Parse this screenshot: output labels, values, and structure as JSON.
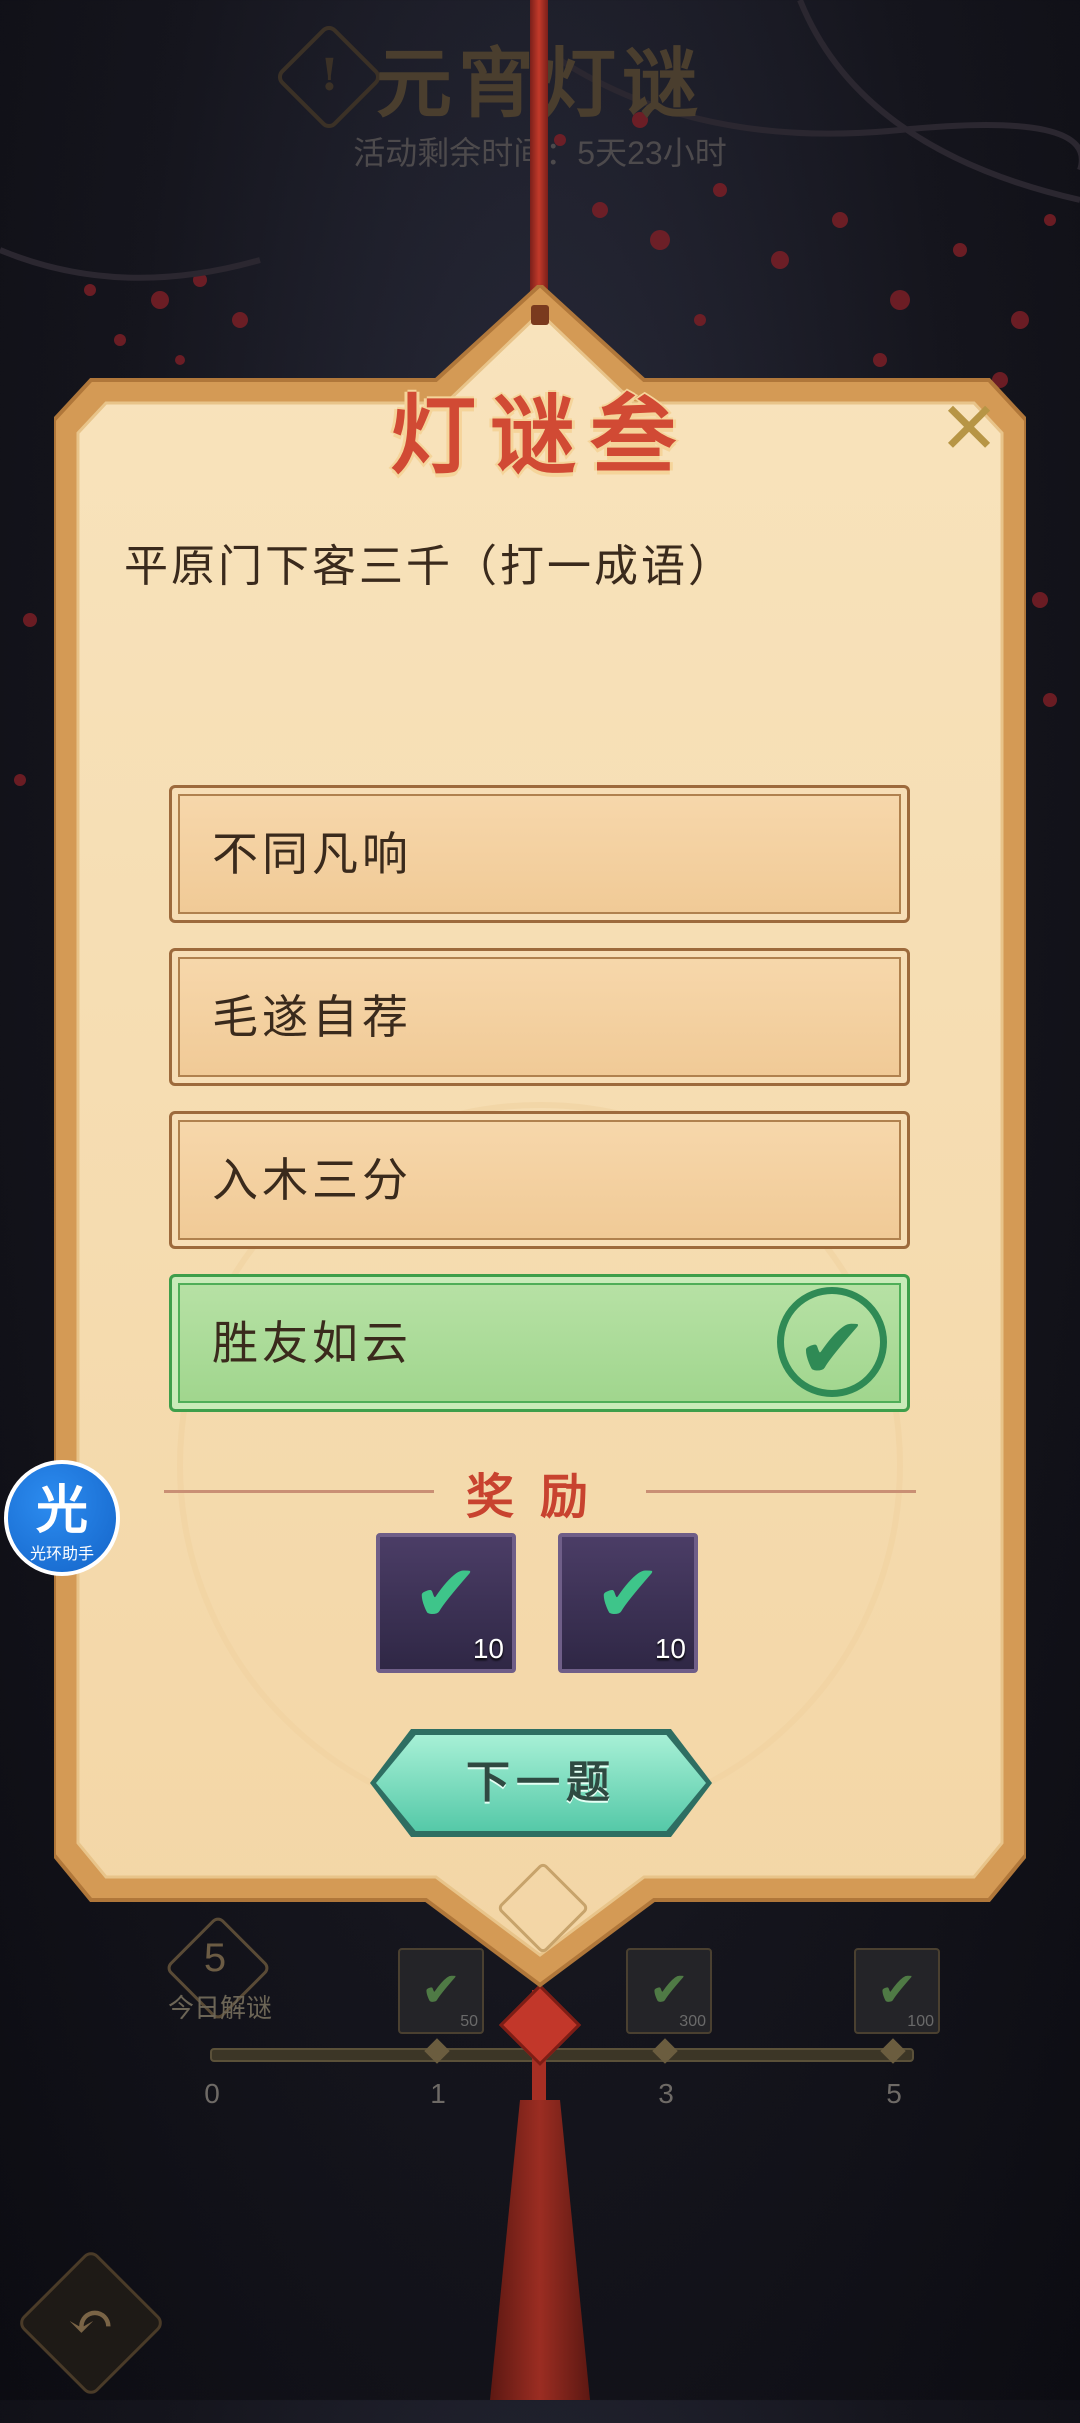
{
  "background": {
    "event_title": "元宵灯谜",
    "timer_text": "活动剩余时间：5天23小时",
    "solved_count": "5",
    "solved_label": "今日解谜",
    "progress_ticks": [
      "0",
      "1",
      "3",
      "5"
    ],
    "milestone_rewards": [
      {
        "amount": "50"
      },
      {
        "amount": "300"
      },
      {
        "amount": "100"
      }
    ]
  },
  "card": {
    "title": "灯谜叁",
    "question": "平原门下客三千（打一成语）",
    "options": [
      {
        "label": "不同凡响",
        "correct": false
      },
      {
        "label": "毛遂自荐",
        "correct": false
      },
      {
        "label": "入木三分",
        "correct": false
      },
      {
        "label": "胜友如云",
        "correct": true
      }
    ],
    "reward_header": "奖励",
    "rewards": [
      {
        "icon": "jade-scroll-icon",
        "qty": "10"
      },
      {
        "icon": "scroll-bundle-icon",
        "qty": "10"
      }
    ],
    "next_button": "下一题"
  },
  "helper": {
    "glyph": "光",
    "name": "光环助手"
  },
  "colors": {
    "title_red": "#d14a34",
    "card_bg": "#f6deb4",
    "correct_green": "#9fd58c",
    "button_teal": "#55c9a8"
  }
}
